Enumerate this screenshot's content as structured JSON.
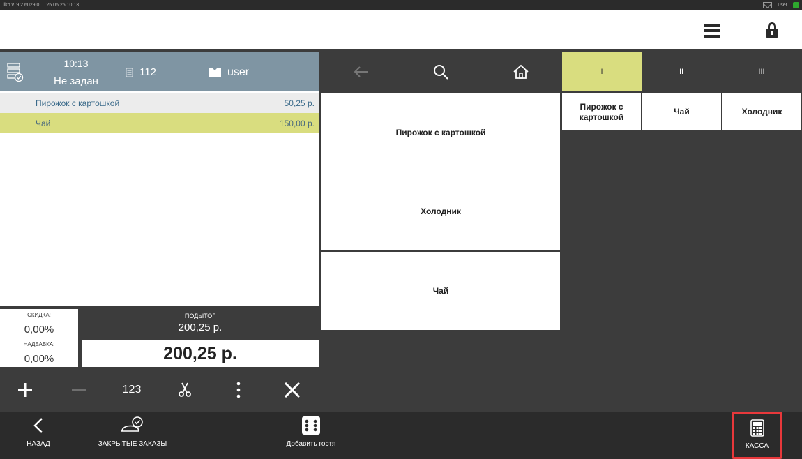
{
  "titlebar": {
    "version": "iiko v. 9.2.6029.0",
    "datetime": "25.06.25   10:13",
    "user": "user",
    "status_color": "#2ea82e"
  },
  "header": {
    "menu_icon": "hamburger-menu-icon",
    "lock_icon": "lock-icon"
  },
  "order": {
    "time": "10:13",
    "table": "Не задан",
    "number": "112",
    "waiter": "user",
    "items": [
      {
        "name": "Пирожок с картошкой",
        "price": "50,25 р."
      },
      {
        "name": "Чай",
        "price": "150,00 р."
      }
    ],
    "discount_label": "СКИДКА:",
    "discount_value": "0,00%",
    "surcharge_label": "НАДБАВКА:",
    "surcharge_value": "0,00%",
    "subtotal_label": "ПОДЫТОГ",
    "subtotal_value": "200,25 р.",
    "total": "200,25 р."
  },
  "actions": {
    "numpad_label": "123"
  },
  "menu": {
    "tiles": [
      "Пирожок с картошкой",
      "Холодник",
      "Чай"
    ],
    "category_tabs": [
      "I",
      "II",
      "III"
    ],
    "quick_items": [
      "Пирожок с картошкой",
      "Чай",
      "Холодник"
    ]
  },
  "bottom": {
    "back_label": "НАЗАД",
    "closed_orders_label": "ЗАКРЫТЫЕ ЗАКАЗЫ",
    "add_guest_label": "Добавить гостя",
    "cash_label": "КАССА"
  },
  "colors": {
    "accent": "#d9dd7f",
    "order_header": "#7f95a3",
    "highlight_border": "#e8383b"
  }
}
